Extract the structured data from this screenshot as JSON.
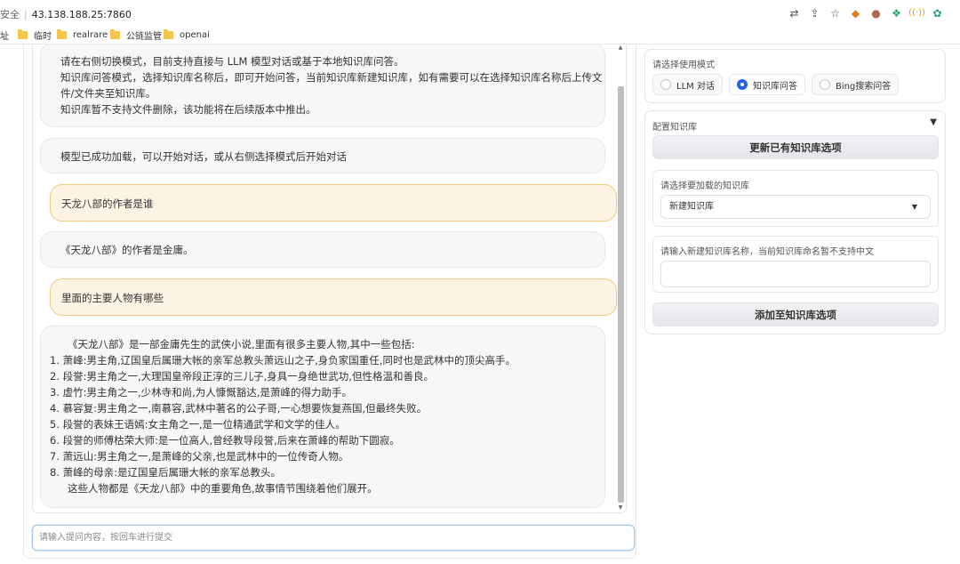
{
  "browser": {
    "security_text": "安全",
    "url": "43.138.188.25:7860",
    "icons": [
      "translate-icon",
      "share-icon",
      "star-icon",
      "metamask-icon",
      "puzzle-icon",
      "eco-icon",
      "broadcast-icon",
      "chatgpt-icon"
    ]
  },
  "bookmarks": [
    {
      "label": "址"
    },
    {
      "label": "临时"
    },
    {
      "label": "realrare"
    },
    {
      "label": "公链监管"
    },
    {
      "label": "openai"
    }
  ],
  "chat": {
    "messages": [
      {
        "role": "bot",
        "lines": [
          "请在右侧切换模式，目前支持直接与 LLM 模型对话或基于本地知识库问答。",
          "知识库问答模式，选择知识库名称后，即可开始问答，当前知识库新建知识库，如有需要可以在选择知识库名称后上传文",
          "件/文件夹至知识库。",
          "知识库暂不支持文件删除，该功能将在后续版本中推出。"
        ]
      },
      {
        "role": "bot",
        "lines": [
          "模型已成功加载，可以开始对话，或从右侧选择模式后开始对话"
        ]
      },
      {
        "role": "user",
        "lines": [
          "天龙八部的作者是谁"
        ]
      },
      {
        "role": "bot",
        "lines": [
          "《天龙八部》的作者是金庸。"
        ]
      },
      {
        "role": "user",
        "lines": [
          "里面的主要人物有哪些"
        ]
      },
      {
        "role": "bot",
        "lines": [
          "《天龙八部》是一部金庸先生的武侠小说,里面有很多主要人物,其中一些包括:",
          "1. 萧峰:男主角,辽国皇后属珊大帐的亲军总教头萧远山之子,身负家国重任,同时也是武林中的顶尖高手。",
          "2. 段誉:男主角之一,大理国皇帝段正淳的三儿子,身具一身绝世武功,但性格温和善良。",
          "3. 虚竹:男主角之一,少林寺和尚,为人慷慨豁达,是萧峰的得力助手。",
          "4. 慕容复:男主角之一,南慕容,武林中著名的公子哥,一心想要恢复燕国,但最终失败。",
          "5. 段誉的表妹王语嫣:女主角之一,是一位精通武学和文学的佳人。",
          "6. 段誉的师傅枯荣大师:是一位高人,曾经教导段誉,后来在萧峰的帮助下圆寂。",
          "7. 萧远山:男主角之一,是萧峰的父亲,也是武林中的一位传奇人物。",
          "8. 萧峰的母亲:是辽国皇后属珊大帐的亲军总教头。",
          "这些人物都是《天龙八部》中的重要角色,故事情节围绕着他们展开。"
        ]
      }
    ],
    "input_placeholder": "请输入提问内容，按回车进行提交"
  },
  "mode": {
    "label": "请选择使用模式",
    "options": [
      "LLM 对话",
      "知识库问答",
      "Bing搜索问答"
    ],
    "selected": "知识库问答"
  },
  "kb": {
    "accordion_title": "配置知识库",
    "accordion_arrow": "▼",
    "refresh_button": "更新已有知识库选项",
    "select_label": "请选择要加载的知识库",
    "select_value": "新建知识库",
    "select_caret": "▼",
    "name_label": "请输入新建知识库名称，当前知识库命名暂不支持中文",
    "name_value": "",
    "add_button": "添加至知识库选项"
  },
  "colors": {
    "accent": "#2563eb",
    "user_bubble": "#fdf3e4",
    "user_border": "#f3c77f",
    "bot_bubble": "#f6f7f9"
  }
}
